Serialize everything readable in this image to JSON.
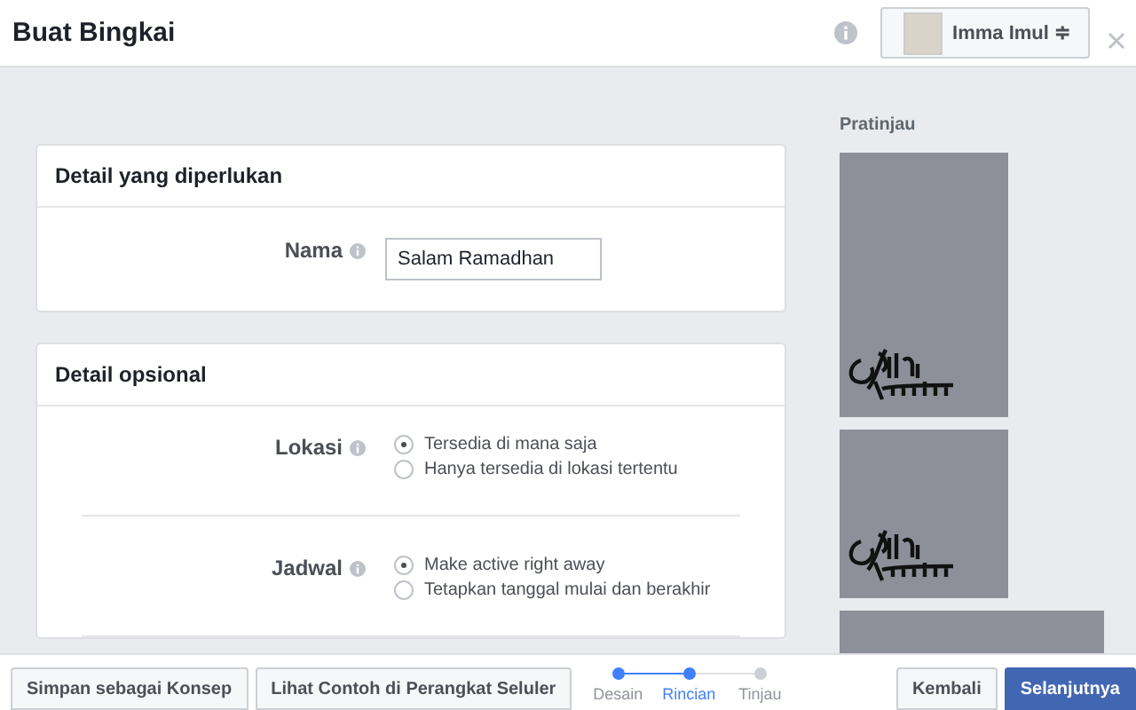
{
  "window": {
    "title": "Buat Bingkai"
  },
  "account": {
    "name": "Imma Imul ≑"
  },
  "required_section": {
    "title": "Detail yang diperlukan",
    "fields": [
      {
        "label": "Nama",
        "value": "Salam Ramadhan"
      }
    ]
  },
  "optional_section": {
    "title": "Detail opsional",
    "groups": [
      {
        "label": "Lokasi",
        "options": [
          {
            "label": "Tersedia di mana saja",
            "selected": true
          },
          {
            "label": "Hanya tersedia di lokasi tertentu",
            "selected": false
          }
        ]
      },
      {
        "label": "Jadwal",
        "options": [
          {
            "label": "Make active right away",
            "selected": true
          },
          {
            "label": "Tetapkan tanggal mulai dan berakhir",
            "selected": false
          }
        ]
      }
    ]
  },
  "preview": {
    "title": "Pratinjau",
    "images": [
      {
        "kind": "tall"
      },
      {
        "kind": "square"
      },
      {
        "kind": "wide"
      }
    ]
  },
  "footer": {
    "left_buttons": [
      "Simpan sebagai Konsep",
      "Lihat Contoh di Perangkat Seluler"
    ],
    "steps": [
      {
        "label": "Desain",
        "done": true,
        "selected": false
      },
      {
        "label": "Rincian",
        "done": true,
        "selected": true
      },
      {
        "label": "Tinjau",
        "done": false,
        "selected": false
      }
    ],
    "back": "Kembali",
    "next": "Selanjutnya"
  }
}
